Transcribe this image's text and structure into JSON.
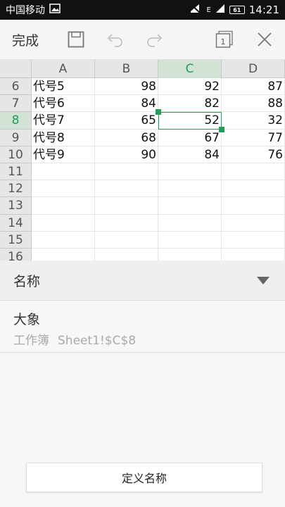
{
  "status": {
    "carrier": "中国移动",
    "network": "E",
    "battery": "61",
    "time": "14:21"
  },
  "toolbar": {
    "done_label": "完成"
  },
  "sheet": {
    "columns": [
      "A",
      "B",
      "C",
      "D"
    ],
    "selected_column": "C",
    "selected_row": "8",
    "rows": [
      {
        "num": "6",
        "cells": [
          "代号5",
          "98",
          "92",
          "87"
        ]
      },
      {
        "num": "7",
        "cells": [
          "代号6",
          "84",
          "82",
          "88"
        ]
      },
      {
        "num": "8",
        "cells": [
          "代号7",
          "65",
          "52",
          "32"
        ]
      },
      {
        "num": "9",
        "cells": [
          "代号8",
          "68",
          "67",
          "77"
        ]
      },
      {
        "num": "10",
        "cells": [
          "代号9",
          "90",
          "84",
          "76"
        ]
      },
      {
        "num": "11",
        "cells": [
          "",
          "",
          "",
          ""
        ]
      },
      {
        "num": "12",
        "cells": [
          "",
          "",
          "",
          ""
        ]
      },
      {
        "num": "13",
        "cells": [
          "",
          "",
          "",
          ""
        ]
      },
      {
        "num": "14",
        "cells": [
          "",
          "",
          "",
          ""
        ]
      },
      {
        "num": "15",
        "cells": [
          "",
          "",
          "",
          ""
        ]
      },
      {
        "num": "16",
        "cells": [
          "",
          "",
          "",
          ""
        ]
      }
    ]
  },
  "name_panel": {
    "label": "名称",
    "item": {
      "name": "大象",
      "scope": "工作簿",
      "reference": "Sheet1!$C$8"
    },
    "define_button": "定义名称"
  },
  "colors": {
    "accent": "#1f9e57",
    "header_bg": "#e6e6e6",
    "selected_header_bg": "#d2e3d6"
  }
}
